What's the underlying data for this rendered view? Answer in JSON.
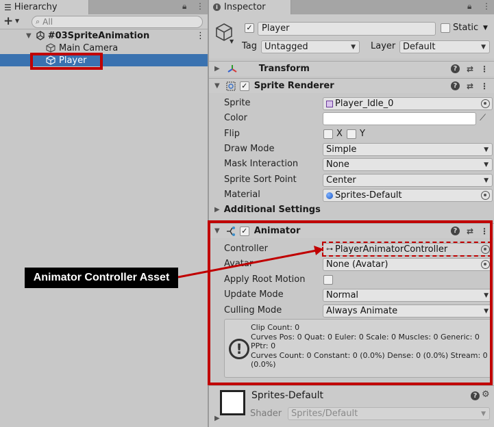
{
  "hierarchy": {
    "tab_label": "Hierarchy",
    "add_label": "+",
    "search_placeholder": "All",
    "scene_name": "#03SpriteAnimation",
    "objects": [
      "Main Camera",
      "Player"
    ]
  },
  "inspector": {
    "tab_label": "Inspector",
    "object_name": "Player",
    "static_label": "Static",
    "tag_label": "Tag",
    "tag_value": "Untagged",
    "layer_label": "Layer",
    "layer_value": "Default",
    "transform": {
      "title": "Transform"
    },
    "sprite_renderer": {
      "title": "Sprite Renderer",
      "labels": {
        "sprite": "Sprite",
        "color": "Color",
        "flip": "Flip",
        "draw_mode": "Draw Mode",
        "mask": "Mask Interaction",
        "sort_point": "Sprite Sort Point",
        "material": "Material"
      },
      "values": {
        "sprite": "Player_Idle_0",
        "flip_x": "X",
        "flip_y": "Y",
        "draw_mode": "Simple",
        "mask": "None",
        "sort_point": "Center",
        "material": "Sprites-Default"
      },
      "additional": "Additional Settings"
    },
    "animator": {
      "title": "Animator",
      "labels": {
        "controller": "Controller",
        "avatar": "Avatar",
        "root_motion": "Apply Root Motion",
        "update_mode": "Update Mode",
        "culling_mode": "Culling Mode"
      },
      "values": {
        "controller": "PlayerAnimatorController",
        "avatar": "None (Avatar)",
        "update_mode": "Normal",
        "culling_mode": "Always Animate"
      },
      "info_lines": [
        "Clip Count: 0",
        "Curves Pos: 0 Quat: 0 Euler: 0 Scale: 0 Muscles: 0 Generic: 0",
        "PPtr: 0",
        "Curves Count: 0 Constant: 0 (0.0%) Dense: 0 (0.0%) Stream: 0",
        "(0.0%)"
      ]
    },
    "material": {
      "name": "Sprites-Default",
      "shader_label": "Shader",
      "shader_value": "Sprites/Default"
    }
  },
  "annotation": {
    "callout": "Animator Controller Asset",
    "color": "#c00000"
  }
}
